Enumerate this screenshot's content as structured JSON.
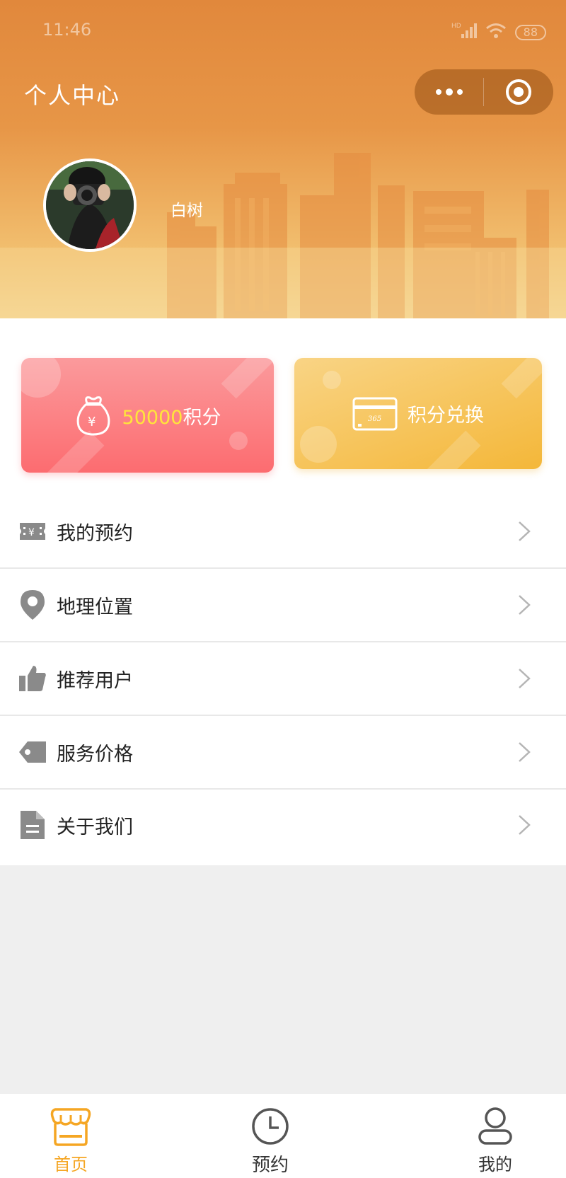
{
  "status_bar": {
    "time": "11:46",
    "network": "HD",
    "battery": "88"
  },
  "header": {
    "title": "个人中心"
  },
  "profile": {
    "username": "白树"
  },
  "cards": {
    "points": {
      "value": "50000",
      "unit": "积分"
    },
    "exchange": {
      "label": "积分兑换",
      "card_text": "365"
    }
  },
  "menu": {
    "items": [
      {
        "label": "我的预约",
        "icon": "ticket-yen-icon"
      },
      {
        "label": "地理位置",
        "icon": "location-pin-icon"
      },
      {
        "label": "推荐用户",
        "icon": "thumbs-up-icon"
      },
      {
        "label": "服务价格",
        "icon": "price-tag-icon"
      },
      {
        "label": "关于我们",
        "icon": "document-icon"
      }
    ]
  },
  "tabbar": {
    "items": [
      {
        "label": "首页",
        "icon": "shop-icon",
        "active": true
      },
      {
        "label": "预约",
        "icon": "clock-icon",
        "active": false
      },
      {
        "label": "我的",
        "icon": "person-icon",
        "active": false
      }
    ]
  },
  "colors": {
    "header_orange": "#e1883c",
    "points_card": "#fc6c70",
    "exchange_card": "#f4b739",
    "points_highlight": "#ffe53b",
    "tab_active": "#f5a623",
    "icon_gray": "#8a8a8a"
  }
}
